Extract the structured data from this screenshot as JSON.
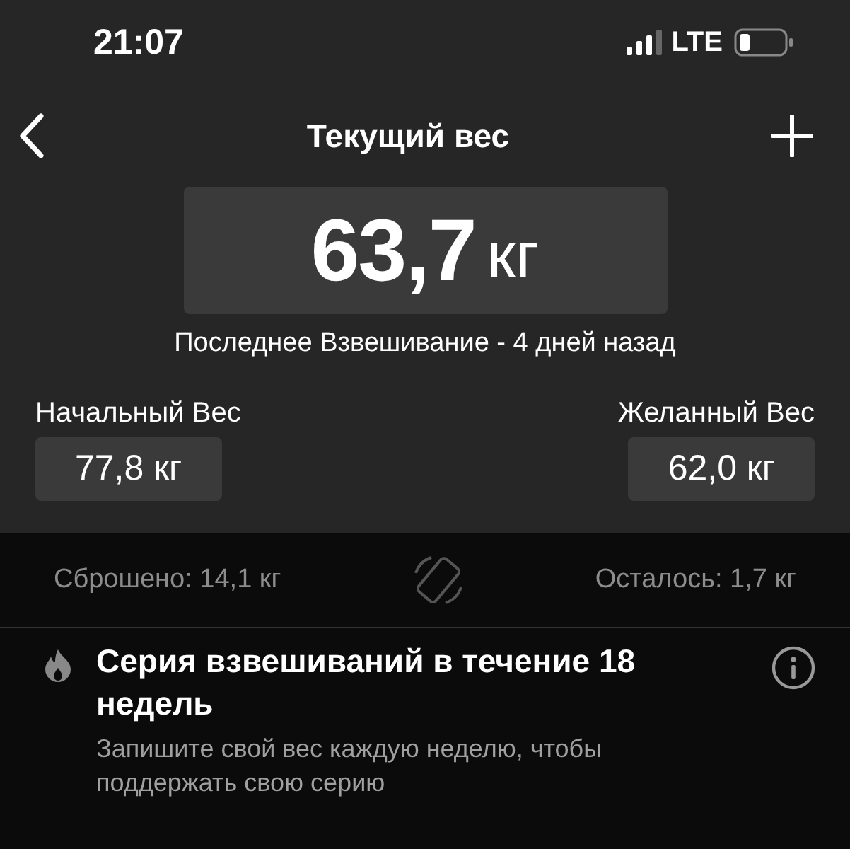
{
  "status_bar": {
    "time": "21:07",
    "network": "LTE"
  },
  "nav": {
    "title": "Текущий вес"
  },
  "current": {
    "value": "63,7",
    "unit": "кг",
    "subtitle": "Последнее Взвешивание - 4 дней назад"
  },
  "weights": [
    {
      "label": "Начальный Вес",
      "value": "77,8 кг"
    },
    {
      "label": "Желанный Вес",
      "value": "62,0 кг"
    }
  ],
  "summary": {
    "lost": "Сброшено: 14,1 кг",
    "left": "Осталось: 1,7 кг"
  },
  "streak": {
    "title": "Серия взвешиваний в течение 18 недель",
    "description": "Запишите свой вес каждую неделю, чтобы поддержать свою серию"
  }
}
